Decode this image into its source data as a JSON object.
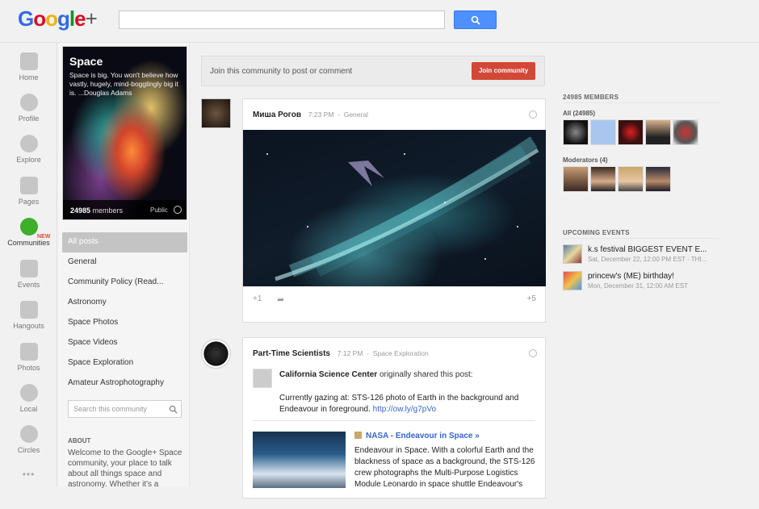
{
  "brand": {
    "g1": "G",
    "o1": "o",
    "o2": "o",
    "g2": "g",
    "l": "l",
    "e": "e",
    "plus": "+"
  },
  "search": {
    "placeholder": ""
  },
  "nav": {
    "items": [
      {
        "label": "Home",
        "icon": "home-icon"
      },
      {
        "label": "Profile",
        "icon": "profile-icon"
      },
      {
        "label": "Explore",
        "icon": "explore-icon"
      },
      {
        "label": "Pages",
        "icon": "pages-icon"
      },
      {
        "label": "Communities",
        "icon": "communities-icon"
      },
      {
        "label": "Events",
        "icon": "events-icon"
      },
      {
        "label": "Hangouts",
        "icon": "hangouts-icon"
      },
      {
        "label": "Photos",
        "icon": "photos-icon"
      },
      {
        "label": "Local",
        "icon": "local-icon"
      },
      {
        "label": "Circles",
        "icon": "circles-icon"
      }
    ],
    "new_badge": "NEW",
    "more": "•••"
  },
  "community": {
    "title": "Space",
    "quote": "Space is big. You won't believe how vastly, hugely, mind-bogglingly big it is. ...Douglas Adams",
    "member_count": "24985",
    "members_label": "members",
    "visibility": "Public",
    "categories": [
      "All posts",
      "General",
      "Community Policy (Read...",
      "Astronomy",
      "Space Photos",
      "Space Videos",
      "Space Exploration",
      "Amateur Astrophotography"
    ],
    "search_placeholder": "Search this community",
    "about_heading": "ABOUT",
    "about_text": "Welcome to the Google+ Space community, your place to talk about all things space and astronomy. Whether it's a"
  },
  "join": {
    "text": "Join this community to post or comment",
    "button": "Join community"
  },
  "posts": [
    {
      "author": "Миша Рогов",
      "time": "7:23 PM",
      "category": "General",
      "plus_one": "+1",
      "share": "➦",
      "plus_count": "+5"
    },
    {
      "author": "Part-Time Scientists",
      "time": "7:12 PM",
      "category": "Space Exploration",
      "reshare_author": "California Science Center",
      "reshare_mid": "originally shared this",
      "reshare_link": "post",
      "reshare_colon": ":",
      "body_text": "Currently gazing at: STS-126 photo of Earth in the background and Endeavour in foreground.",
      "body_link": "http://ow.ly/g7pVo",
      "link_title": "NASA - Endeavour in Space »",
      "link_desc": "Endeavour in Space. With a colorful Earth and the blackness of space as a background, the STS-126 crew photographs the Multi-Purpose Logistics Module Leonardo in space shuttle Endeavour's"
    }
  ],
  "members": {
    "heading": "24985 MEMBERS",
    "all_label": "All (24985)",
    "moderators_label": "Moderators (4)"
  },
  "events": {
    "heading": "UPCOMING EVENTS",
    "items": [
      {
        "title": "k.s festival BIGGEST EVENT E...",
        "date": "Sat, December 22, 12:00 PM EST - THI..."
      },
      {
        "title": "princew's (ME) birthday!",
        "date": "Mon, December 31, 12:00 AM EST"
      }
    ]
  },
  "colors": {
    "accent": "#4d90fe",
    "join": "#d14836",
    "active_nav": "#3fae2a",
    "link": "#3366cc"
  }
}
